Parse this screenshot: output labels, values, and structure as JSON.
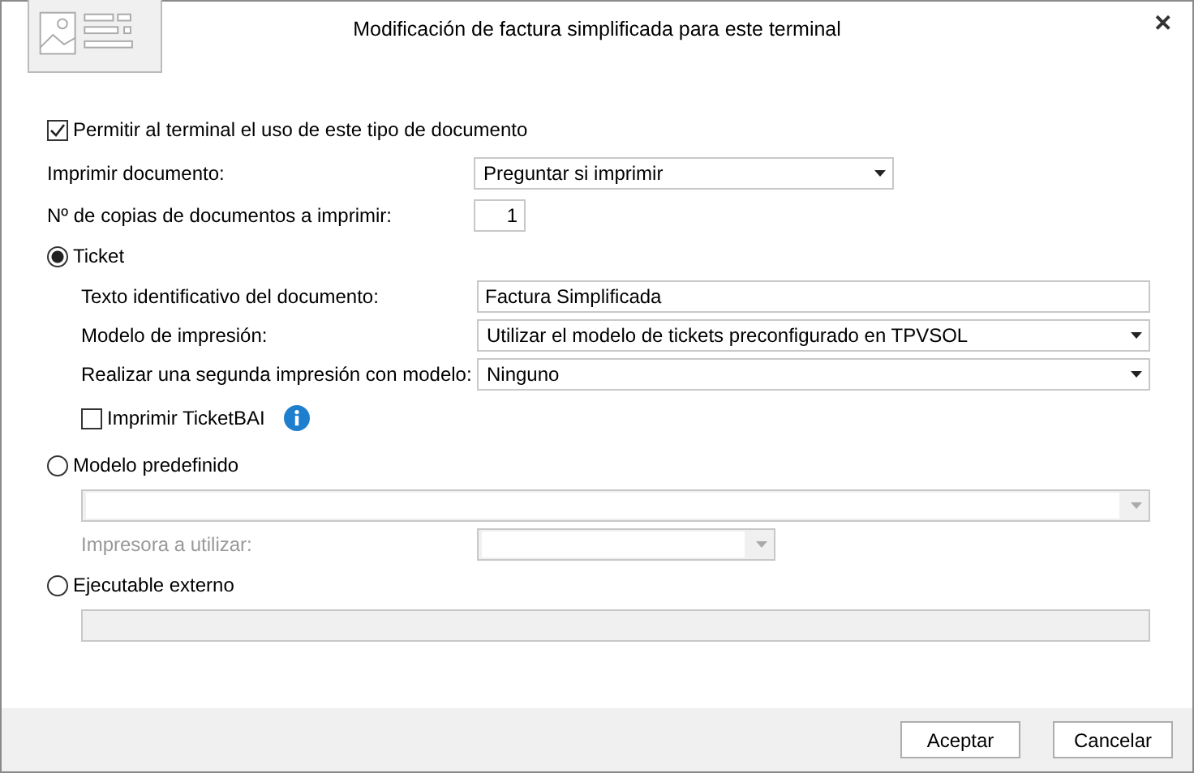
{
  "window": {
    "title": "Modificación de factura simplificada para este terminal",
    "close": "✕"
  },
  "allow": {
    "label": "Permitir al terminal el uso de este tipo de documento",
    "checked": true
  },
  "print_document": {
    "label": "Imprimir documento:",
    "value": "Preguntar si imprimir"
  },
  "copies": {
    "label": "Nº de copias de documentos a imprimir:",
    "value": "1"
  },
  "options": [
    {
      "label": "Ticket",
      "selected": true,
      "rows": [
        {
          "kind": "text",
          "label": "Texto identificativo del documento:",
          "value": "Factura Simplificada",
          "disabled": false
        },
        {
          "kind": "select",
          "label": "Modelo de impresión:",
          "value": "Utilizar el modelo de tickets preconfigurado en TPVSOL",
          "disabled": false
        },
        {
          "kind": "select",
          "label": "Realizar una segunda impresión con modelo:",
          "value": "Ninguno",
          "disabled": false
        },
        {
          "kind": "checkbox",
          "label": "Imprimir TicketBAI",
          "checked": false
        }
      ]
    },
    {
      "label": "Modelo predefinido",
      "selected": false,
      "rows": [
        {
          "kind": "select",
          "disabled": true
        },
        {
          "kind": "select",
          "label": "Impresora a utilizar:",
          "disabled": true
        }
      ]
    },
    {
      "label": "Ejecutable externo",
      "selected": false,
      "rows": [
        {
          "kind": "text",
          "disabled": true
        }
      ]
    }
  ],
  "buttons": [
    "Aceptar",
    "Cancelar"
  ]
}
